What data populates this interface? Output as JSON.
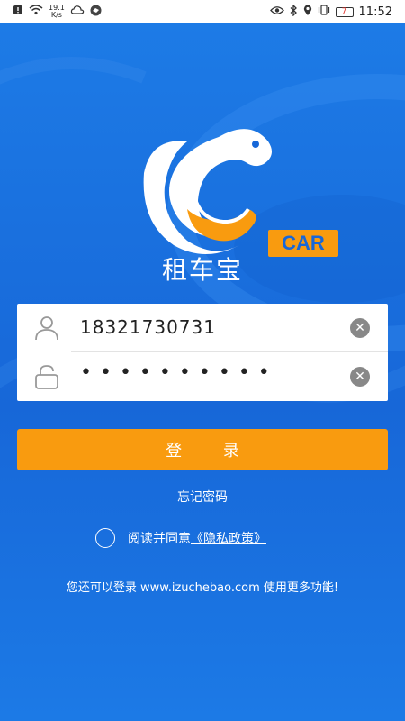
{
  "status_bar": {
    "network_speed": "19.1\nK/s",
    "battery_level": "7",
    "time": "11:52"
  },
  "logo": {
    "badge_text": "CAR"
  },
  "app_name": "租车宝",
  "form": {
    "username_value": "18321730731",
    "password_masked": "••••••••••"
  },
  "login_button": "登 录",
  "forgot_password": "忘记密码",
  "agreement": {
    "text": "阅读并同意",
    "link": "《隐私政策》"
  },
  "footer_text": "您还可以登录 www.izuchebao.com 使用更多功能!",
  "colors": {
    "background": "#1a73e0",
    "accent_orange": "#f99b0f",
    "white": "#ffffff"
  }
}
